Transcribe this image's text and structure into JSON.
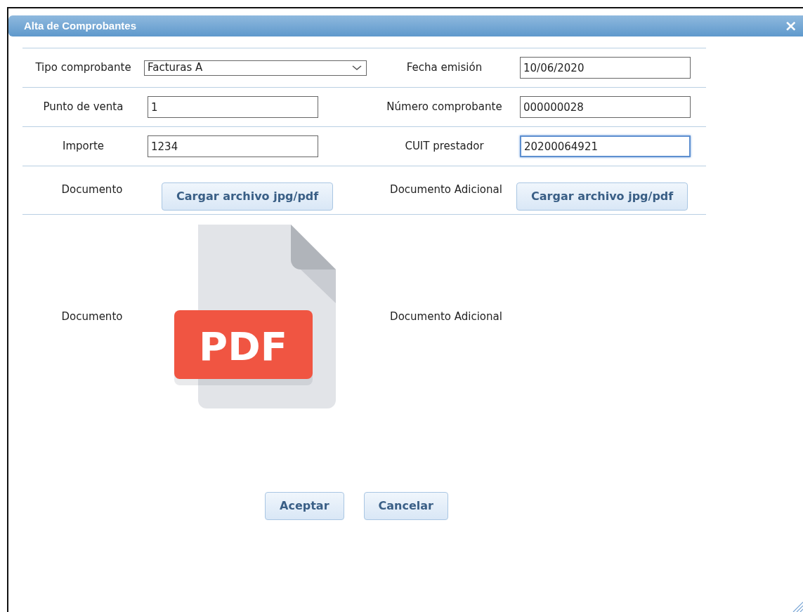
{
  "window": {
    "title": "Alta de Comprobantes",
    "close_label": "×"
  },
  "rows": [
    {
      "fields": [
        {
          "label": "Tipo comprobante",
          "kind": "select",
          "value": "Facturas A",
          "focused": false
        },
        {
          "label": "Fecha emisión",
          "kind": "text",
          "value": "10/06/2020",
          "focused": false
        }
      ]
    },
    {
      "fields": [
        {
          "label": "Punto de venta",
          "kind": "text",
          "value": "1",
          "focused": false
        },
        {
          "label": "Número comprobante",
          "kind": "text",
          "value": "000000028",
          "focused": false
        }
      ]
    },
    {
      "fields": [
        {
          "label": "Importe",
          "kind": "text",
          "value": "1234",
          "focused": false
        },
        {
          "label": "CUIT prestador",
          "kind": "text",
          "value": "20200064921",
          "focused": true
        }
      ]
    }
  ],
  "documents": [
    {
      "label": "Documento",
      "button": "Cargar archivo jpg/pdf"
    },
    {
      "label": "Documento Adicional",
      "button": "Cargar archivo jpg/pdf"
    }
  ],
  "preview": [
    {
      "label": "Documento",
      "file": {
        "kind": "pdf",
        "badge": "PDF"
      }
    },
    {
      "label": "Documento Adicional"
    }
  ],
  "buttons": [
    "Aceptar",
    "Cancelar"
  ]
}
